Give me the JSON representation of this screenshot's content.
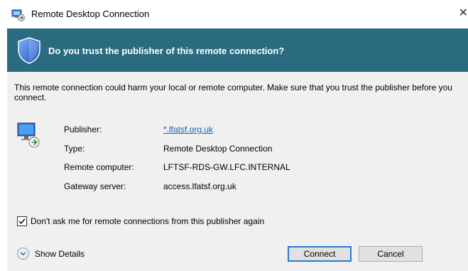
{
  "window": {
    "title": "Remote Desktop Connection",
    "close_glyph": "✕",
    "app_icon": "remote-desktop-icon"
  },
  "banner": {
    "heading": "Do you trust the publisher of this remote connection?",
    "icon": "shield-icon",
    "color": "#2a6b80"
  },
  "body": {
    "warning": "This remote connection could harm your local or remote computer. Make sure that you trust the publisher before you connect.",
    "icon": "computer-connection-icon",
    "details": [
      {
        "label": "Publisher:",
        "value": "*.lfatsf.org.uk",
        "is_link": true
      },
      {
        "label": "Type:",
        "value": "Remote Desktop Connection",
        "is_link": false
      },
      {
        "label": "Remote computer:",
        "value": "LFTSF-RDS-GW.LFC.INTERNAL",
        "is_link": false
      },
      {
        "label": "Gateway server:",
        "value": "access.lfatsf.org.uk",
        "is_link": false
      }
    ]
  },
  "checkbox": {
    "label": "Don't ask me for remote connections from this publisher again",
    "checked": true
  },
  "footer": {
    "show_details_label": "Show Details",
    "connect_label": "Connect",
    "cancel_label": "Cancel"
  }
}
